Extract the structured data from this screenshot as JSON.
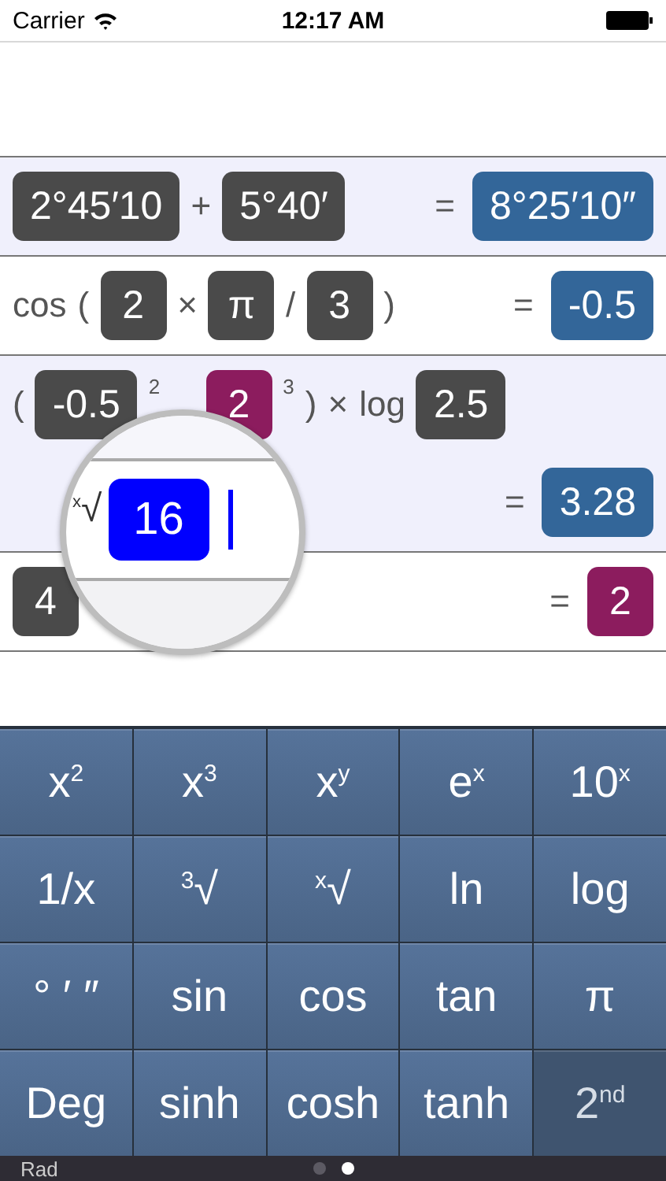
{
  "status_bar": {
    "carrier": "Carrier",
    "time": "12:17 AM"
  },
  "rows": [
    {
      "lines": [
        {
          "tokens": [
            {
              "kind": "box",
              "text": "2°45′10",
              "color": "#4a4a4a"
            },
            {
              "kind": "op",
              "text": "+"
            },
            {
              "kind": "box",
              "text": "5°40′",
              "color": "#4a4a4a"
            }
          ],
          "result": {
            "equals": "=",
            "text": "8°25′10″",
            "color": "#336699"
          }
        }
      ]
    },
    {
      "lines": [
        {
          "tokens": [
            {
              "kind": "op",
              "text": "cos"
            },
            {
              "kind": "op",
              "text": "("
            },
            {
              "kind": "box",
              "text": "2",
              "color": "#4a4a4a"
            },
            {
              "kind": "op",
              "text": "×"
            },
            {
              "kind": "box",
              "text": "π",
              "color": "#4a4a4a"
            },
            {
              "kind": "op",
              "text": "/"
            },
            {
              "kind": "box",
              "text": "3",
              "color": "#4a4a4a"
            },
            {
              "kind": "op",
              "text": ")"
            }
          ],
          "result": {
            "equals": "=",
            "text": "-0.5",
            "color": "#336699"
          }
        }
      ]
    },
    {
      "lines": [
        {
          "tokens": [
            {
              "kind": "op",
              "text": "("
            },
            {
              "kind": "box",
              "text": "-0.5",
              "color": "#4a4a4a"
            },
            {
              "kind": "sup",
              "text": "2"
            },
            {
              "kind": "box",
              "text": "2",
              "color": "#8c1c5e"
            },
            {
              "kind": "sup",
              "text": "3"
            },
            {
              "kind": "op",
              "text": ")"
            },
            {
              "kind": "op",
              "text": "×"
            },
            {
              "kind": "op",
              "text": "log"
            },
            {
              "kind": "box",
              "text": "2.5",
              "color": "#4a4a4a"
            }
          ]
        },
        {
          "result": {
            "equals": "=",
            "text": "3.28",
            "color": "#336699"
          }
        }
      ]
    },
    {
      "lines": [
        {
          "tokens": [
            {
              "kind": "box",
              "text": "4",
              "color": "#4a4a4a"
            }
          ],
          "result": {
            "equals": "=",
            "text": "2",
            "color": "#8c1c5e"
          }
        }
      ]
    }
  ],
  "loupe": {
    "tokens": [
      {
        "kind": "op",
        "text": "$^{x}$√"
      },
      {
        "kind": "box",
        "text": "16",
        "color": "#0000ff"
      }
    ],
    "cursor": true
  },
  "keys": [
    {
      "label": "x$^{2}$",
      "kind": "fn"
    },
    {
      "label": "x$^{3}$",
      "kind": "fn"
    },
    {
      "label": "x$^{y}$",
      "kind": "fn"
    },
    {
      "label": "e$^{x}$",
      "kind": "fn"
    },
    {
      "label": "10$^{x}$",
      "kind": "fn"
    },
    {
      "label": "1/x",
      "kind": "fn"
    },
    {
      "label": "$^{3}$√",
      "kind": "fn"
    },
    {
      "label": "$^{x}$√",
      "kind": "fn"
    },
    {
      "label": "ln",
      "kind": "fn"
    },
    {
      "label": "log",
      "kind": "fn"
    },
    {
      "label": "° ′ ″",
      "kind": "fn"
    },
    {
      "label": "sin",
      "kind": "fn"
    },
    {
      "label": "cos",
      "kind": "fn"
    },
    {
      "label": "tan",
      "kind": "fn"
    },
    {
      "label": "π",
      "kind": "fn"
    },
    {
      "label": "Deg",
      "kind": "fn"
    },
    {
      "label": "sinh",
      "kind": "fn"
    },
    {
      "label": "cosh",
      "kind": "fn"
    },
    {
      "label": "tanh",
      "kind": "fn"
    },
    {
      "label": "2$^{nd}$",
      "kind": "shift"
    }
  ],
  "bottom_bar": {
    "mode": "Rad",
    "pages": [
      {
        "selected": false
      },
      {
        "selected": true
      }
    ]
  }
}
